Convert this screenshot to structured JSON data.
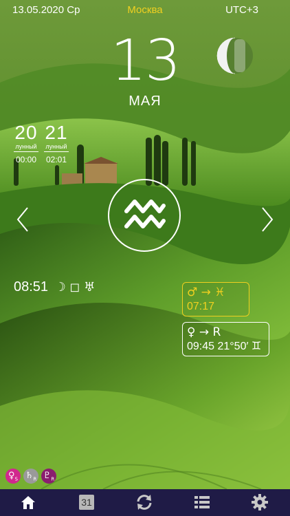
{
  "status_bar": {
    "date": "13.05.2020 Ср",
    "city": "Москва",
    "timezone": "UTC+3"
  },
  "day": {
    "number": "13",
    "month": "мая"
  },
  "lunar_days": [
    {
      "number": "20",
      "label": "лунный",
      "time": "00:00"
    },
    {
      "number": "21",
      "label": "лунный",
      "time": "02:01"
    }
  ],
  "moon_aspect": {
    "time": "08:51",
    "glyphs": "☽ ◻ ♅"
  },
  "events": [
    {
      "line1": "♂ → ♓",
      "line2": "07:17",
      "color": "#f0d020"
    },
    {
      "line1": "♀ → R",
      "line2": "09:45 21°50′ ♊",
      "color": "#ffffff"
    }
  ],
  "retrograde_badges": [
    {
      "glyph": "♀",
      "sub": "S",
      "color": "#d1288e"
    },
    {
      "glyph": "♄",
      "sub": "R",
      "color": "#9a9a9a"
    },
    {
      "glyph": "♇",
      "sub": "R",
      "color": "#8a1d6f"
    }
  ],
  "bottom_nav": {
    "calendar_day": "31"
  },
  "colors": {
    "accent_yellow": "#f0d020",
    "nav_bg": "#1f1b46"
  },
  "icons": [
    "moon-phase-icon",
    "aquarius-icon",
    "chevron-left-icon",
    "chevron-right-icon",
    "home-icon",
    "calendar-icon",
    "sync-icon",
    "list-icon",
    "gear-icon"
  ]
}
